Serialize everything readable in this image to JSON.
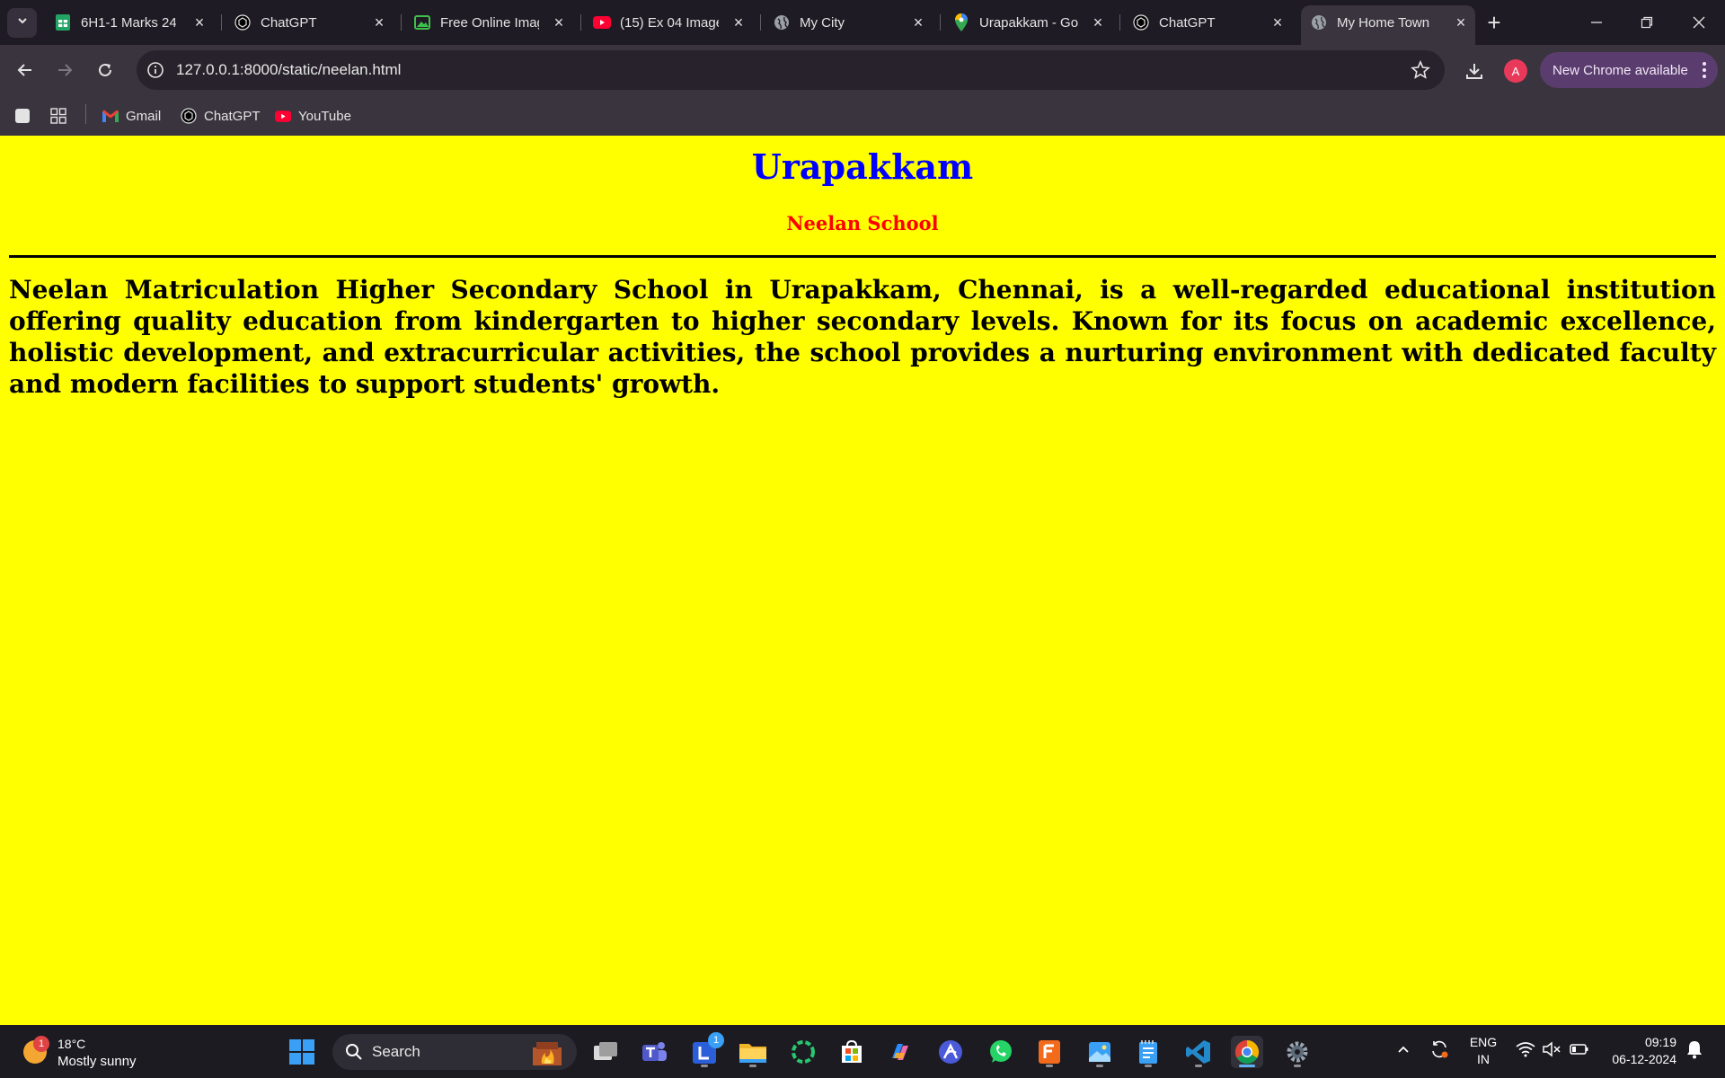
{
  "browser": {
    "tabs": [
      {
        "title": "6H1-1 Marks 24-",
        "icon": "sheets-icon",
        "active": false
      },
      {
        "title": "ChatGPT",
        "icon": "chatgpt-icon",
        "active": false
      },
      {
        "title": "Free Online Imag",
        "icon": "image-editor-icon",
        "active": false
      },
      {
        "title": "(15) Ex 04 Image",
        "icon": "youtube-icon",
        "active": false
      },
      {
        "title": "My City",
        "icon": "globe-icon",
        "active": false
      },
      {
        "title": "Urapakkam - Go",
        "icon": "maps-pin-icon",
        "active": false
      },
      {
        "title": "ChatGPT",
        "icon": "chatgpt-icon",
        "active": false
      },
      {
        "title": "My Home Town",
        "icon": "globe-icon",
        "active": true
      }
    ],
    "url": "127.0.0.1:8000/static/neelan.html",
    "profile_initial": "A",
    "update_label": "New Chrome available",
    "bookmarks": [
      {
        "label": "Gmail",
        "icon": "gmail-icon"
      },
      {
        "label": "ChatGPT",
        "icon": "chatgpt-icon"
      },
      {
        "label": "YouTube",
        "icon": "youtube-icon"
      }
    ]
  },
  "page": {
    "background": "#ffff00",
    "heading": "Urapakkam",
    "heading_color": "#0000ff",
    "subheading": "Neelan School",
    "subheading_color": "#ff0000",
    "paragraph": "Neelan Matriculation Higher Secondary School in Urapakkam, Chennai, is a well-regarded educational institution offering quality education from kindergarten to higher secondary levels. Known for its focus on academic excellence, holistic development, and extracurricular activities, the school provides a nurturing environment with dedicated faculty and modern facilities to support students' growth."
  },
  "taskbar": {
    "weather_badge": "1",
    "temperature": "18°C",
    "condition": "Mostly sunny",
    "search_label": "Search",
    "lens_badge": "1",
    "language_top": "ENG",
    "language_bottom": "IN",
    "time": "09:19",
    "date": "06-12-2024"
  }
}
